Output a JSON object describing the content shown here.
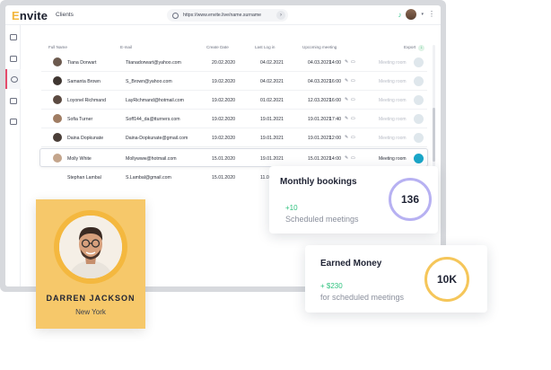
{
  "app": {
    "logo": "Envite",
    "page_title": "Clients",
    "url": "https://www.envite.live/name.surname"
  },
  "sidebar": {
    "items": [
      {
        "icon": "grid-icon"
      },
      {
        "icon": "monitor-icon"
      },
      {
        "icon": "clients-icon",
        "active": true
      },
      {
        "icon": "contact-card-icon"
      },
      {
        "icon": "card-icon"
      }
    ]
  },
  "table": {
    "headers": {
      "name": "Full Name",
      "email": "E-mail",
      "created": "Create Date",
      "last_login": "Last Log in",
      "upcoming": "Upcoming meeting",
      "export": "Export"
    },
    "rows": [
      {
        "name": "Tiana Dorwart",
        "email": "Tiianadorwart@yahoo.com",
        "created": "20.02.2020",
        "last_login": "04.02.2021",
        "upcoming_date": "04.03.2021",
        "upcoming_time": "14:00",
        "meeting": "Meeting room"
      },
      {
        "name": "Samanta Brown",
        "email": "S_Brown@yahoo.com",
        "created": "19.02.2020",
        "last_login": "04.02.2021",
        "upcoming_date": "04.03.2021",
        "upcoming_time": "16:00",
        "meeting": "Meeting room"
      },
      {
        "name": "Loyonel Richmand",
        "email": "LayRichmand@hotmail.com",
        "created": "19.02.2020",
        "last_login": "01.02.2021",
        "upcoming_date": "12.03.2021",
        "upcoming_time": "16:00",
        "meeting": "Meeting room"
      },
      {
        "name": "Sofia Turner",
        "email": "Soff144_da@tturners.com",
        "created": "19.02.2020",
        "last_login": "19.01.2021",
        "upcoming_date": "19.01.2021",
        "upcoming_time": "17:40",
        "meeting": "Meeting room"
      },
      {
        "name": "Daina Dopkunate",
        "email": "Daina-Dopkunate@gmail.com",
        "created": "19.02.2020",
        "last_login": "19.01.2021",
        "upcoming_date": "19.01.2021",
        "upcoming_time": "12:00",
        "meeting": "Meeting room"
      },
      {
        "name": "Molly White",
        "email": "Mollywww@hotmail.com",
        "created": "15.01.2020",
        "last_login": "19.01.2021",
        "upcoming_date": "15.01.2021",
        "upcoming_time": "14:00",
        "meeting": "Meeting room"
      },
      {
        "name": "Stephan Lambal",
        "email": "S.Lambal@gmail.com",
        "created": "15.01.2020",
        "last_login": "11.01.20",
        "upcoming_date": "",
        "upcoming_time": "",
        "meeting": ""
      }
    ]
  },
  "cards": {
    "bookings": {
      "title": "Monthly bookings",
      "delta": "+10",
      "sub": "Scheduled meetings",
      "value": "136",
      "ring_color": "#b7b1f2"
    },
    "money": {
      "title": "Earned Money",
      "delta": "+ $230",
      "sub": "for scheduled meetings",
      "value": "10K",
      "ring_color": "#f5c65a"
    }
  },
  "profile": {
    "name": "DARREN JACKSON",
    "city": "New York"
  }
}
